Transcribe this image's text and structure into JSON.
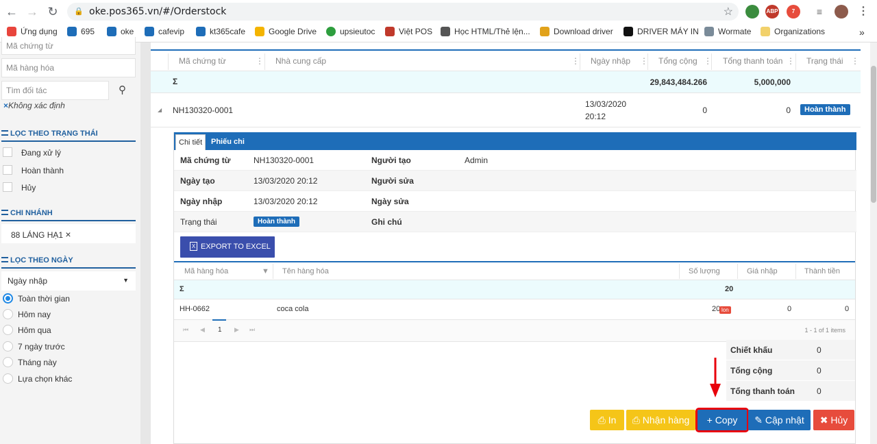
{
  "browser": {
    "url": "oke.pos365.vn/#/Orderstock",
    "bookmarks": [
      "Ứng dụng",
      "695",
      "oke",
      "cafevip",
      "kt365cafe",
      "Google Drive",
      "upsieutoc",
      "Việt POS",
      "Học HTML/Thẻ lện...",
      "Download driver",
      "DRIVER MÁY IN",
      "Wormate",
      "Organizations"
    ],
    "ext_abp": "ABP",
    "ext_badge": "7"
  },
  "sidebar": {
    "doc_placeholder": "Mã chứng từ",
    "item_placeholder": "Mã hàng hóa",
    "partner_placeholder": "Tìm đối tác",
    "unknown_tag": "Không xác định",
    "status_title": "LỌC THEO TRẠNG THÁI",
    "status_options": [
      "Đang xử lý",
      "Hoàn thành",
      "Hủy"
    ],
    "branch_title": "CHI NHÁNH",
    "branch_value": "88 LÁNG HẠ1",
    "date_title": "LỌC THEO NGÀY",
    "date_select": "Ngày nhập",
    "date_options": [
      "Toàn thời gian",
      "Hôm nay",
      "Hôm qua",
      "7 ngày trước",
      "Tháng này",
      "Lựa chọn khác"
    ]
  },
  "grid": {
    "headers": [
      "Mã chứng từ",
      "Nhà cung cấp",
      "Ngày nhập",
      "Tổng cộng",
      "Tổng thanh toán",
      "Trạng thái"
    ],
    "sum_symbol": "Σ",
    "sum_total": "29,843,484.266",
    "sum_paid": "5,000,000",
    "row": {
      "code": "NH130320-0001",
      "date_line1": "13/03/2020",
      "date_line2": "20:12",
      "total": "0",
      "paid": "0",
      "status": "Hoàn thành"
    }
  },
  "detail": {
    "tabs": [
      "Chi tiết",
      "Phiếu chi"
    ],
    "fields": {
      "doc_label": "Mã chứng từ",
      "doc_value": "NH130320-0001",
      "creator_label": "Người tạo",
      "creator_value": "Admin",
      "created_label": "Ngày tạo",
      "created_value": "13/03/2020 20:12",
      "editor_label": "Người sửa",
      "import_label": "Ngày nhập",
      "import_value": "13/03/2020 20:12",
      "edit_date_label": "Ngày sửa",
      "status_label": "Trạng thái",
      "status_value": "Hoàn thành",
      "note_label": "Ghi chú"
    },
    "export_label": "EXPORT TO EXCEL",
    "sub_headers": [
      "Mã hàng hóa",
      "Tên hàng hóa",
      "Số lượng",
      "Giá nhập",
      "Thành tiền"
    ],
    "sub_sum_symbol": "Σ",
    "sub_sum_qty": "20",
    "item": {
      "code": "HH-0662",
      "name": "coca cola",
      "qty": "20",
      "unit": "lon",
      "price": "0",
      "amount": "0"
    },
    "pager_page": "1",
    "pager_info": "1 - 1 of 1 items",
    "totals": [
      {
        "label": "Chiết khấu",
        "value": "0"
      },
      {
        "label": "Tổng cộng",
        "value": "0"
      },
      {
        "label": "Tổng thanh toán",
        "value": "0"
      }
    ],
    "buttons": {
      "print": "In",
      "receive": "Nhận hàng",
      "copy": "Copy",
      "update": "Cập nhật",
      "cancel": "Hủy"
    }
  },
  "colors": {
    "primary": "#1e6db8",
    "warning": "#f5c518",
    "danger": "#e74c3c",
    "highlight": "#e8000b"
  }
}
